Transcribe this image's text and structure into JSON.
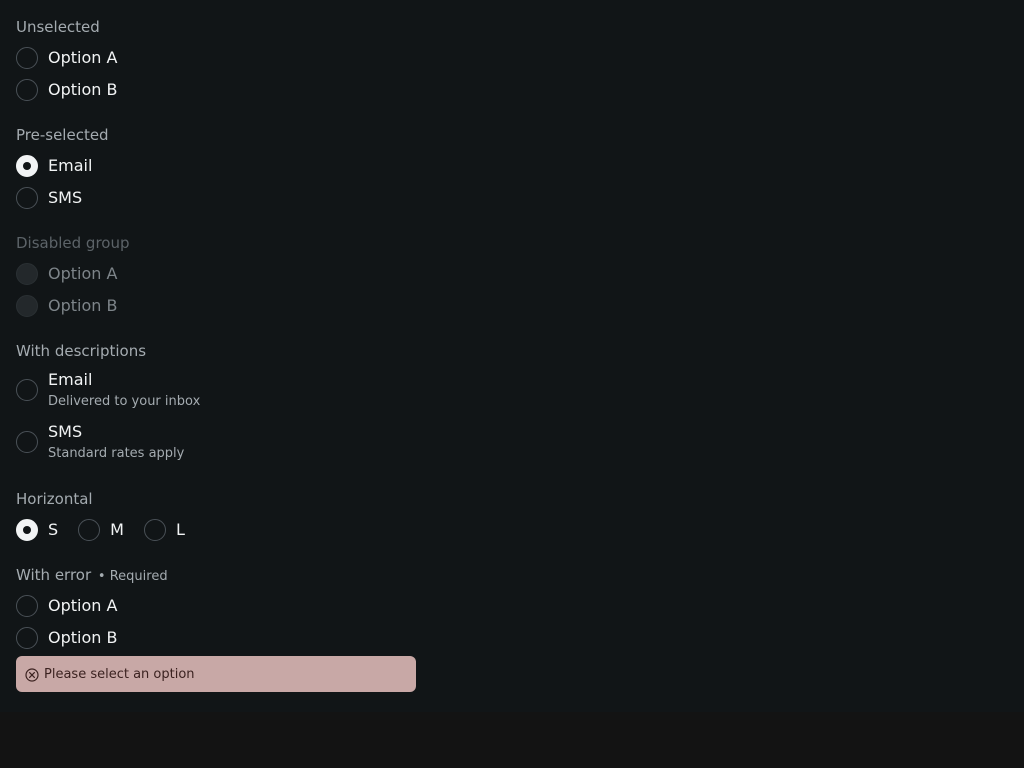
{
  "groups": {
    "unselected": {
      "label": "Unselected",
      "options": [
        "Option A",
        "Option B"
      ]
    },
    "preselected": {
      "label": "Pre-selected",
      "options": [
        "Email",
        "SMS"
      ],
      "selected": "Email"
    },
    "disabled": {
      "label": "Disabled group",
      "options": [
        "Option A",
        "Option B"
      ]
    },
    "descriptions": {
      "label": "With descriptions",
      "options": [
        {
          "label": "Email",
          "description": "Delivered to your inbox"
        },
        {
          "label": "SMS",
          "description": "Standard rates apply"
        }
      ]
    },
    "horizontal": {
      "label": "Horizontal",
      "options": [
        "S",
        "M",
        "L"
      ],
      "selected": "S"
    },
    "error": {
      "label": "With error",
      "required": "• Required",
      "options": [
        "Option A",
        "Option B"
      ],
      "message": "Please select an option",
      "icon": "error-circle-x-icon"
    }
  },
  "colors": {
    "background": "#111517",
    "error_bg": "#c8a8a6",
    "error_text": "#3b2220"
  }
}
